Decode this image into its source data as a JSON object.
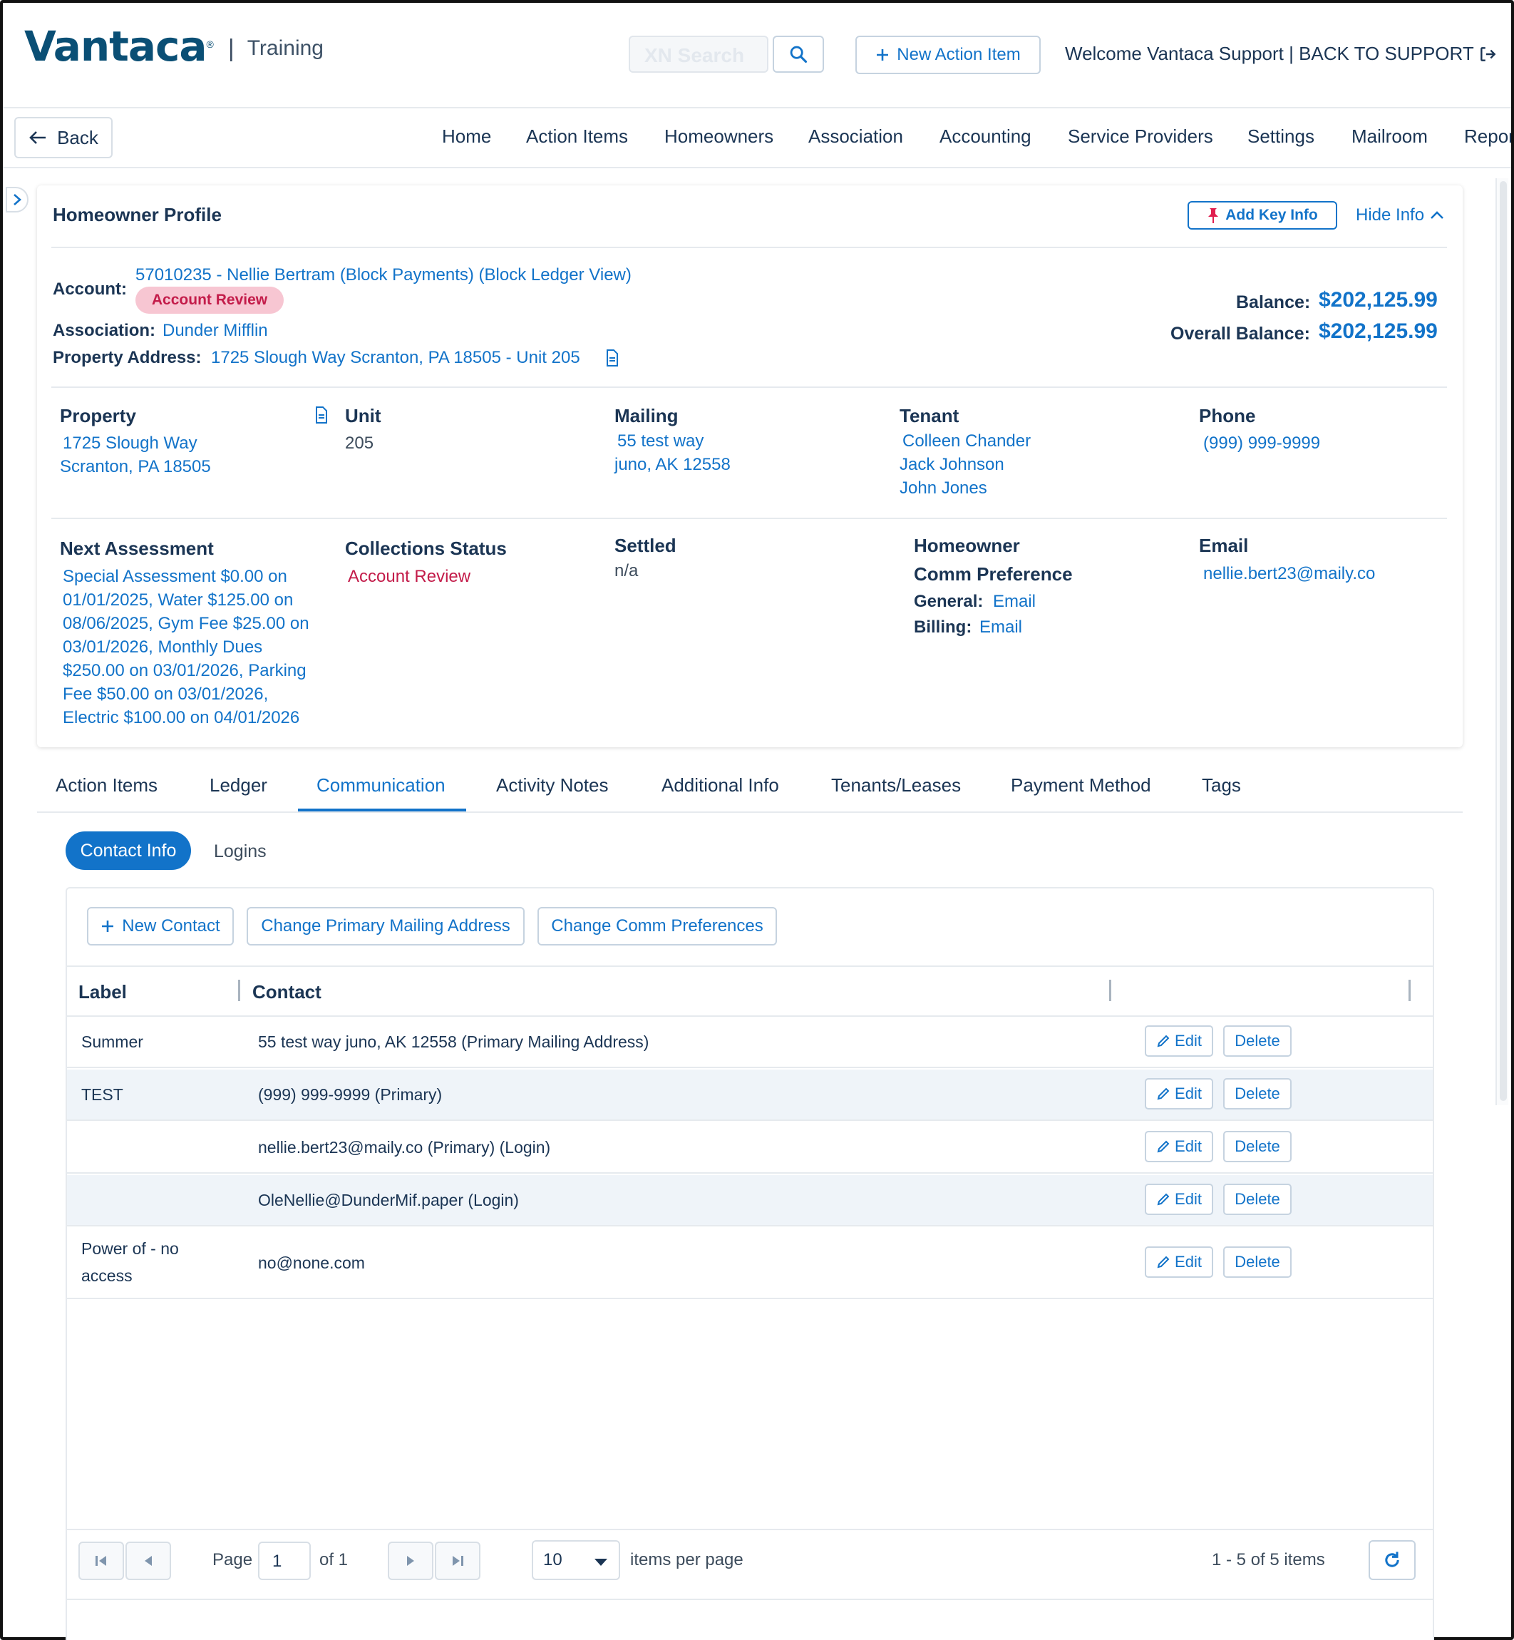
{
  "header": {
    "brand": "Vantaca",
    "brand_suffix": "Training",
    "search_placeholder": "XN Search",
    "new_action_label": "New Action Item",
    "welcome_text": "Welcome Vantaca Support | BACK TO SUPPORT"
  },
  "nav": {
    "back_label": "Back",
    "items": [
      "Home",
      "Action Items",
      "Homeowners",
      "Association",
      "Accounting",
      "Service Providers",
      "Settings",
      "Mailroom",
      "Reports"
    ]
  },
  "profile": {
    "title": "Homeowner Profile",
    "add_key_info": "Add Key Info",
    "hide_info": "Hide Info",
    "account_label": "Account:",
    "account_value": "57010235 - Nellie Bertram (Block Payments) (Block Ledger View)",
    "account_badge": "Account Review",
    "association_label": "Association:",
    "association_value": "Dunder Mifflin",
    "property_address_label": "Property Address:",
    "property_address_value": "1725 Slough Way Scranton, PA 18505 - Unit 205",
    "balance_label": "Balance:",
    "balance_value": "$202,125.99",
    "overall_balance_label": "Overall Balance:",
    "overall_balance_value": "$202,125.99",
    "property": {
      "label": "Property",
      "line1": "1725 Slough Way",
      "line2": "Scranton, PA 18505"
    },
    "unit": {
      "label": "Unit",
      "value": "205"
    },
    "mailing": {
      "label": "Mailing",
      "line1": "55 test way",
      "line2": "juno, AK 12558"
    },
    "tenant": {
      "label": "Tenant",
      "names": [
        "Colleen Chander",
        "Jack Johnson",
        "John Jones"
      ]
    },
    "phone": {
      "label": "Phone",
      "value": "(999) 999-9999"
    },
    "next_assessment": {
      "label": "Next Assessment",
      "lines": [
        "Special Assessment $0.00 on",
        "01/01/2025, Water $125.00 on",
        "08/06/2025, Gym Fee $25.00 on",
        "03/01/2026, Monthly Dues",
        "$250.00 on 03/01/2026, Parking",
        "Fee $50.00 on 03/01/2026,",
        "Electric $100.00 on 04/01/2026"
      ]
    },
    "collections": {
      "label": "Collections Status",
      "value": "Account Review"
    },
    "settled": {
      "label": "Settled",
      "value": "n/a"
    },
    "comm": {
      "label1": "Homeowner",
      "label2": "Comm Preference",
      "general_label": "General:",
      "general_value": "Email",
      "billing_label": "Billing:",
      "billing_value": "Email"
    },
    "email": {
      "label": "Email",
      "value": "nellie.bert23@maily.co"
    }
  },
  "tabs": [
    "Action Items",
    "Ledger",
    "Communication",
    "Activity Notes",
    "Additional Info",
    "Tenants/Leases",
    "Payment Method",
    "Tags"
  ],
  "subtabs": {
    "active": "Contact Info",
    "other": "Logins"
  },
  "toolbar": {
    "new_contact": "New Contact",
    "change_mailing": "Change Primary Mailing Address",
    "change_comm": "Change Comm Preferences"
  },
  "grid": {
    "headers": {
      "label": "Label",
      "contact": "Contact"
    },
    "edit_label": "Edit",
    "delete_label": "Delete",
    "rows": [
      {
        "label": "Summer",
        "contact": "55 test way juno, AK 12558 (Primary Mailing Address)"
      },
      {
        "label": "TEST",
        "contact": "(999) 999-9999 (Primary)"
      },
      {
        "label": "",
        "contact": "nellie.bert23@maily.co (Primary) (Login)"
      },
      {
        "label": "",
        "contact": "OleNellie@DunderMif.paper (Login)"
      },
      {
        "label_line1": "Power of - no",
        "label_line2": "access",
        "contact": "no@none.com"
      }
    ]
  },
  "pager": {
    "page_label": "Page",
    "page_value": "1",
    "of_label": "of 1",
    "page_size": "10",
    "per_page_label": "items per page",
    "summary": "1 - 5 of 5 items"
  },
  "colors": {
    "accent": "#1273c9",
    "text": "#1b3554",
    "badge_bg": "#f7c6d2",
    "badge_text": "#c31c4a",
    "row_alt": "#eff4f9"
  }
}
